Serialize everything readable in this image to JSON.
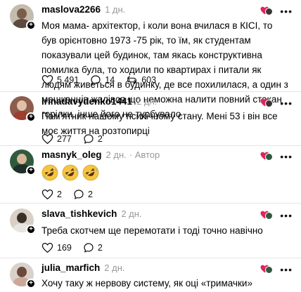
{
  "comments": [
    {
      "username": "maslova2266",
      "time": "1 дн.",
      "text": "Моя мама- архітектор, і коли вона вчилася в КІСІ, то був орієнтовно 1973 -75 рік, то їм, як студентам показували цей будинок, там якась конструктивна помилка була, то ходили по квартирах і питали як людям живеться в будинку, де все похилилася, а один з мешканців жалівся що неможна налити повний стакан горілки, інше його не турбувало",
      "likes": "5 491",
      "replies": "14",
      "shares": "603"
    },
    {
      "username": "irinadavydenko1441",
      "time": "2 дн.",
      "text": "Пам'ятник нашому психічному стану. Мені 53 і він все моє життя на розтопирці",
      "likes": "277",
      "replies": "2"
    },
    {
      "username": "masnyk_oleg",
      "time": "2 дн.",
      "author_label": "· Автор",
      "emojis": [
        "rolling-on-floor-laughing",
        "rolling-on-floor-laughing",
        "rolling-on-floor-laughing"
      ],
      "likes": "2",
      "replies": "2"
    },
    {
      "username": "slava_tishkevich",
      "time": "2 дн.",
      "text": "Треба скотчем ще перемотати і тоді точно навічно",
      "likes": "169",
      "replies": "2"
    },
    {
      "username": "julia_marfich",
      "time": "2 дн.",
      "text": "Хочу таку ж нервову систему, як оці «тримачки»"
    }
  ],
  "icons": {
    "like": "heart-icon",
    "reply": "comment-bubble-icon",
    "share": "share-icon",
    "more": "more-options-icon",
    "liked_by": "liked-heart-icon",
    "add": "plus-icon"
  },
  "colors": {
    "muted": "#999999",
    "separator": "#e6e6e6",
    "liked_heart": "#e0245e"
  }
}
